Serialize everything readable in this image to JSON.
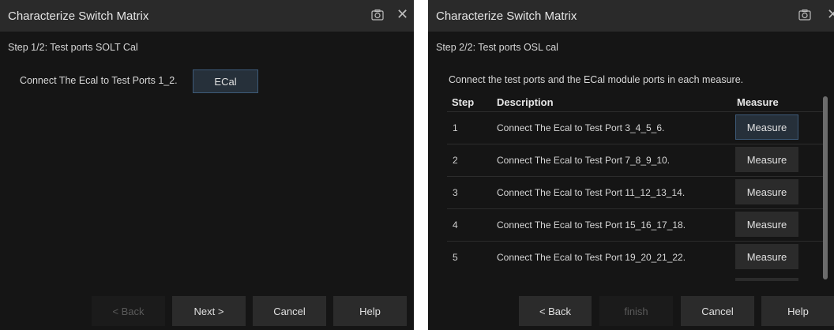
{
  "dialog1": {
    "title": "Characterize Switch Matrix",
    "step_heading": "Step 1/2: Test ports SOLT Cal",
    "instruction": "Connect The Ecal to Test Ports 1_2.",
    "ecal_label": "ECal",
    "buttons": {
      "back": "< Back",
      "next": "Next >",
      "cancel": "Cancel",
      "help": "Help"
    }
  },
  "dialog2": {
    "title": "Characterize Switch Matrix",
    "step_heading": "Step 2/2: Test ports OSL cal",
    "instruction": "Connect the test ports and the ECal module ports in each measure.",
    "columns": {
      "step": "Step",
      "description": "Description",
      "measure": "Measure"
    },
    "rows": [
      {
        "step": "1",
        "description": "Connect The Ecal to Test Port 3_4_5_6.",
        "action": "Measure"
      },
      {
        "step": "2",
        "description": "Connect The Ecal to Test Port 7_8_9_10.",
        "action": "Measure"
      },
      {
        "step": "3",
        "description": "Connect The Ecal to Test Port 11_12_13_14.",
        "action": "Measure"
      },
      {
        "step": "4",
        "description": "Connect The Ecal to Test Port 15_16_17_18.",
        "action": "Measure"
      },
      {
        "step": "5",
        "description": "Connect The Ecal to Test Port 19_20_21_22.",
        "action": "Measure"
      }
    ],
    "buttons": {
      "back": "< Back",
      "finish": "finish",
      "cancel": "Cancel",
      "help": "Help"
    }
  },
  "icons": {
    "screenshot": "camera-icon",
    "close": "close-icon"
  },
  "colors": {
    "background": "#151515",
    "titlebar": "#2a2a2a",
    "button": "#2b2b2b",
    "focus_border": "#3d5a78"
  }
}
